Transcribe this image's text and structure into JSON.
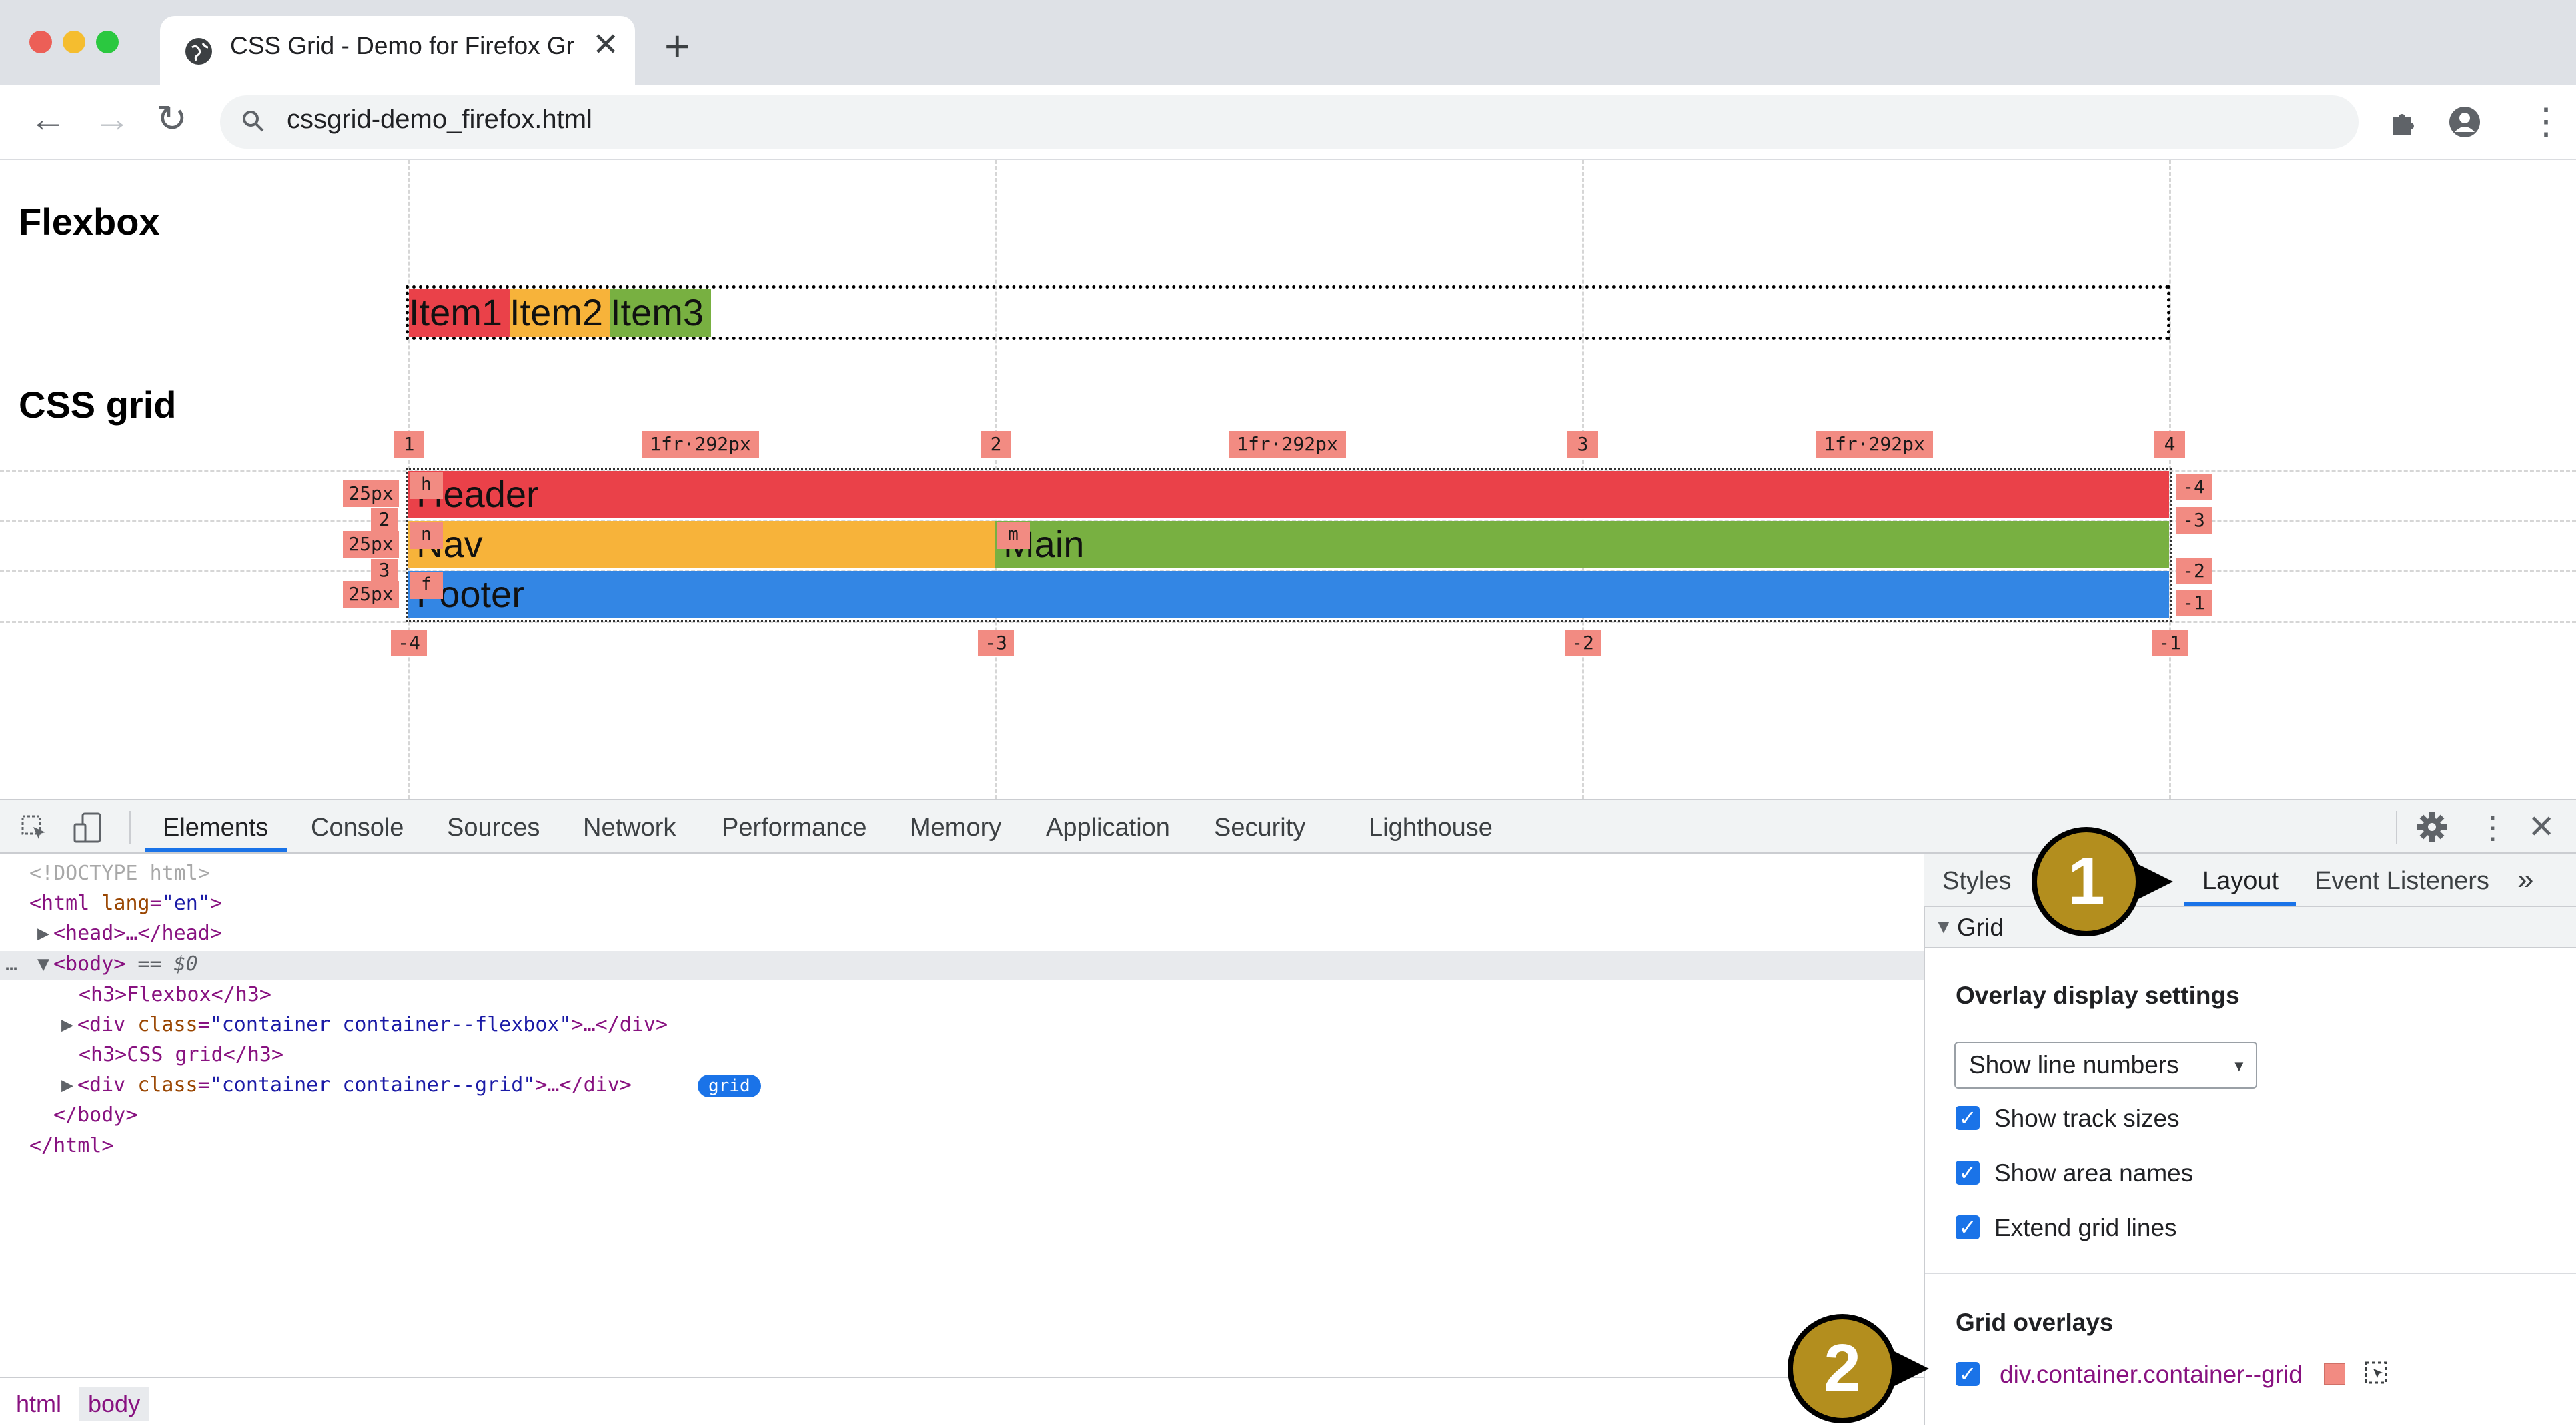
{
  "browser": {
    "tab_title": "CSS Grid - Demo for Firefox Gr",
    "new_tab_glyph": "+",
    "close_glyph": "✕",
    "url": "cssgrid-demo_firefox.html",
    "nav": {
      "back": "←",
      "forward": "→",
      "reload": "↻"
    },
    "menu_glyph": "⋮"
  },
  "page": {
    "flexbox_heading": "Flexbox",
    "flex_items": [
      "Item1",
      "Item2",
      "Item3"
    ],
    "grid_heading": "CSS grid",
    "grid_areas": {
      "header": "Header",
      "nav": "Nav",
      "main": "Main",
      "footer": "Footer"
    },
    "col_numbers_top": [
      "1",
      "2",
      "3",
      "4"
    ],
    "col_numbers_bottom": [
      "-4",
      "-3",
      "-2",
      "-1"
    ],
    "track_sizes": [
      "1fr·292px",
      "1fr·292px",
      "1fr·292px"
    ],
    "row_sizes": [
      "25px",
      "25px",
      "25px"
    ],
    "row_numbers_left": [
      "2",
      "3"
    ],
    "row_numbers_right": [
      "-4",
      "-3",
      "-2",
      "-1"
    ],
    "area_badges": [
      "h",
      "n",
      "m",
      "f"
    ],
    "colors": {
      "header": "#ea4149",
      "nav": "#f7b33a",
      "main": "#78b041",
      "footer": "#3386e4",
      "item1": "#ea4149",
      "item2": "#f7b33a",
      "item3": "#78b041",
      "badge": "#f28b82"
    }
  },
  "devtools": {
    "tabs": [
      "Elements",
      "Console",
      "Sources",
      "Network",
      "Performance",
      "Memory",
      "Application",
      "Security",
      "Lighthouse"
    ],
    "active_tab": "Elements",
    "dom": {
      "doctype": "<!DOCTYPE html>",
      "html_open_tag": "<html",
      "lang_attr": " lang",
      "lang_val": "\"en\"",
      "head": "<head>…</head>",
      "body_open": "<body>",
      "body_marker": " == $0",
      "h3_flex": "<h3>Flexbox</h3>",
      "div_open": "<div ",
      "class_attr": "class",
      "eq": "=",
      "flex_class": "\"container container--flexbox\"",
      "div_close": ">…</div>",
      "h3_grid": "<h3>CSS grid</h3>",
      "grid_class": "\"container container--grid\"",
      "grid_badge": "grid",
      "body_close": "</body>",
      "html_close": "</html>",
      "ellipsis": "…"
    },
    "breadcrumbs": [
      "html",
      "body"
    ],
    "sidebar": {
      "tabs": [
        "Styles",
        "Layout",
        "Event Listeners"
      ],
      "more": "»",
      "active": "Layout",
      "section": "Grid",
      "overlay_settings_title": "Overlay display settings",
      "select_value": "Show line numbers",
      "checkboxes": [
        {
          "label": "Show track sizes",
          "checked": true
        },
        {
          "label": "Show area names",
          "checked": true
        },
        {
          "label": "Extend grid lines",
          "checked": true
        }
      ],
      "grid_overlays_title": "Grid overlays",
      "overlay_item": "div.container.container--grid"
    }
  },
  "callouts": [
    "1",
    "2"
  ]
}
